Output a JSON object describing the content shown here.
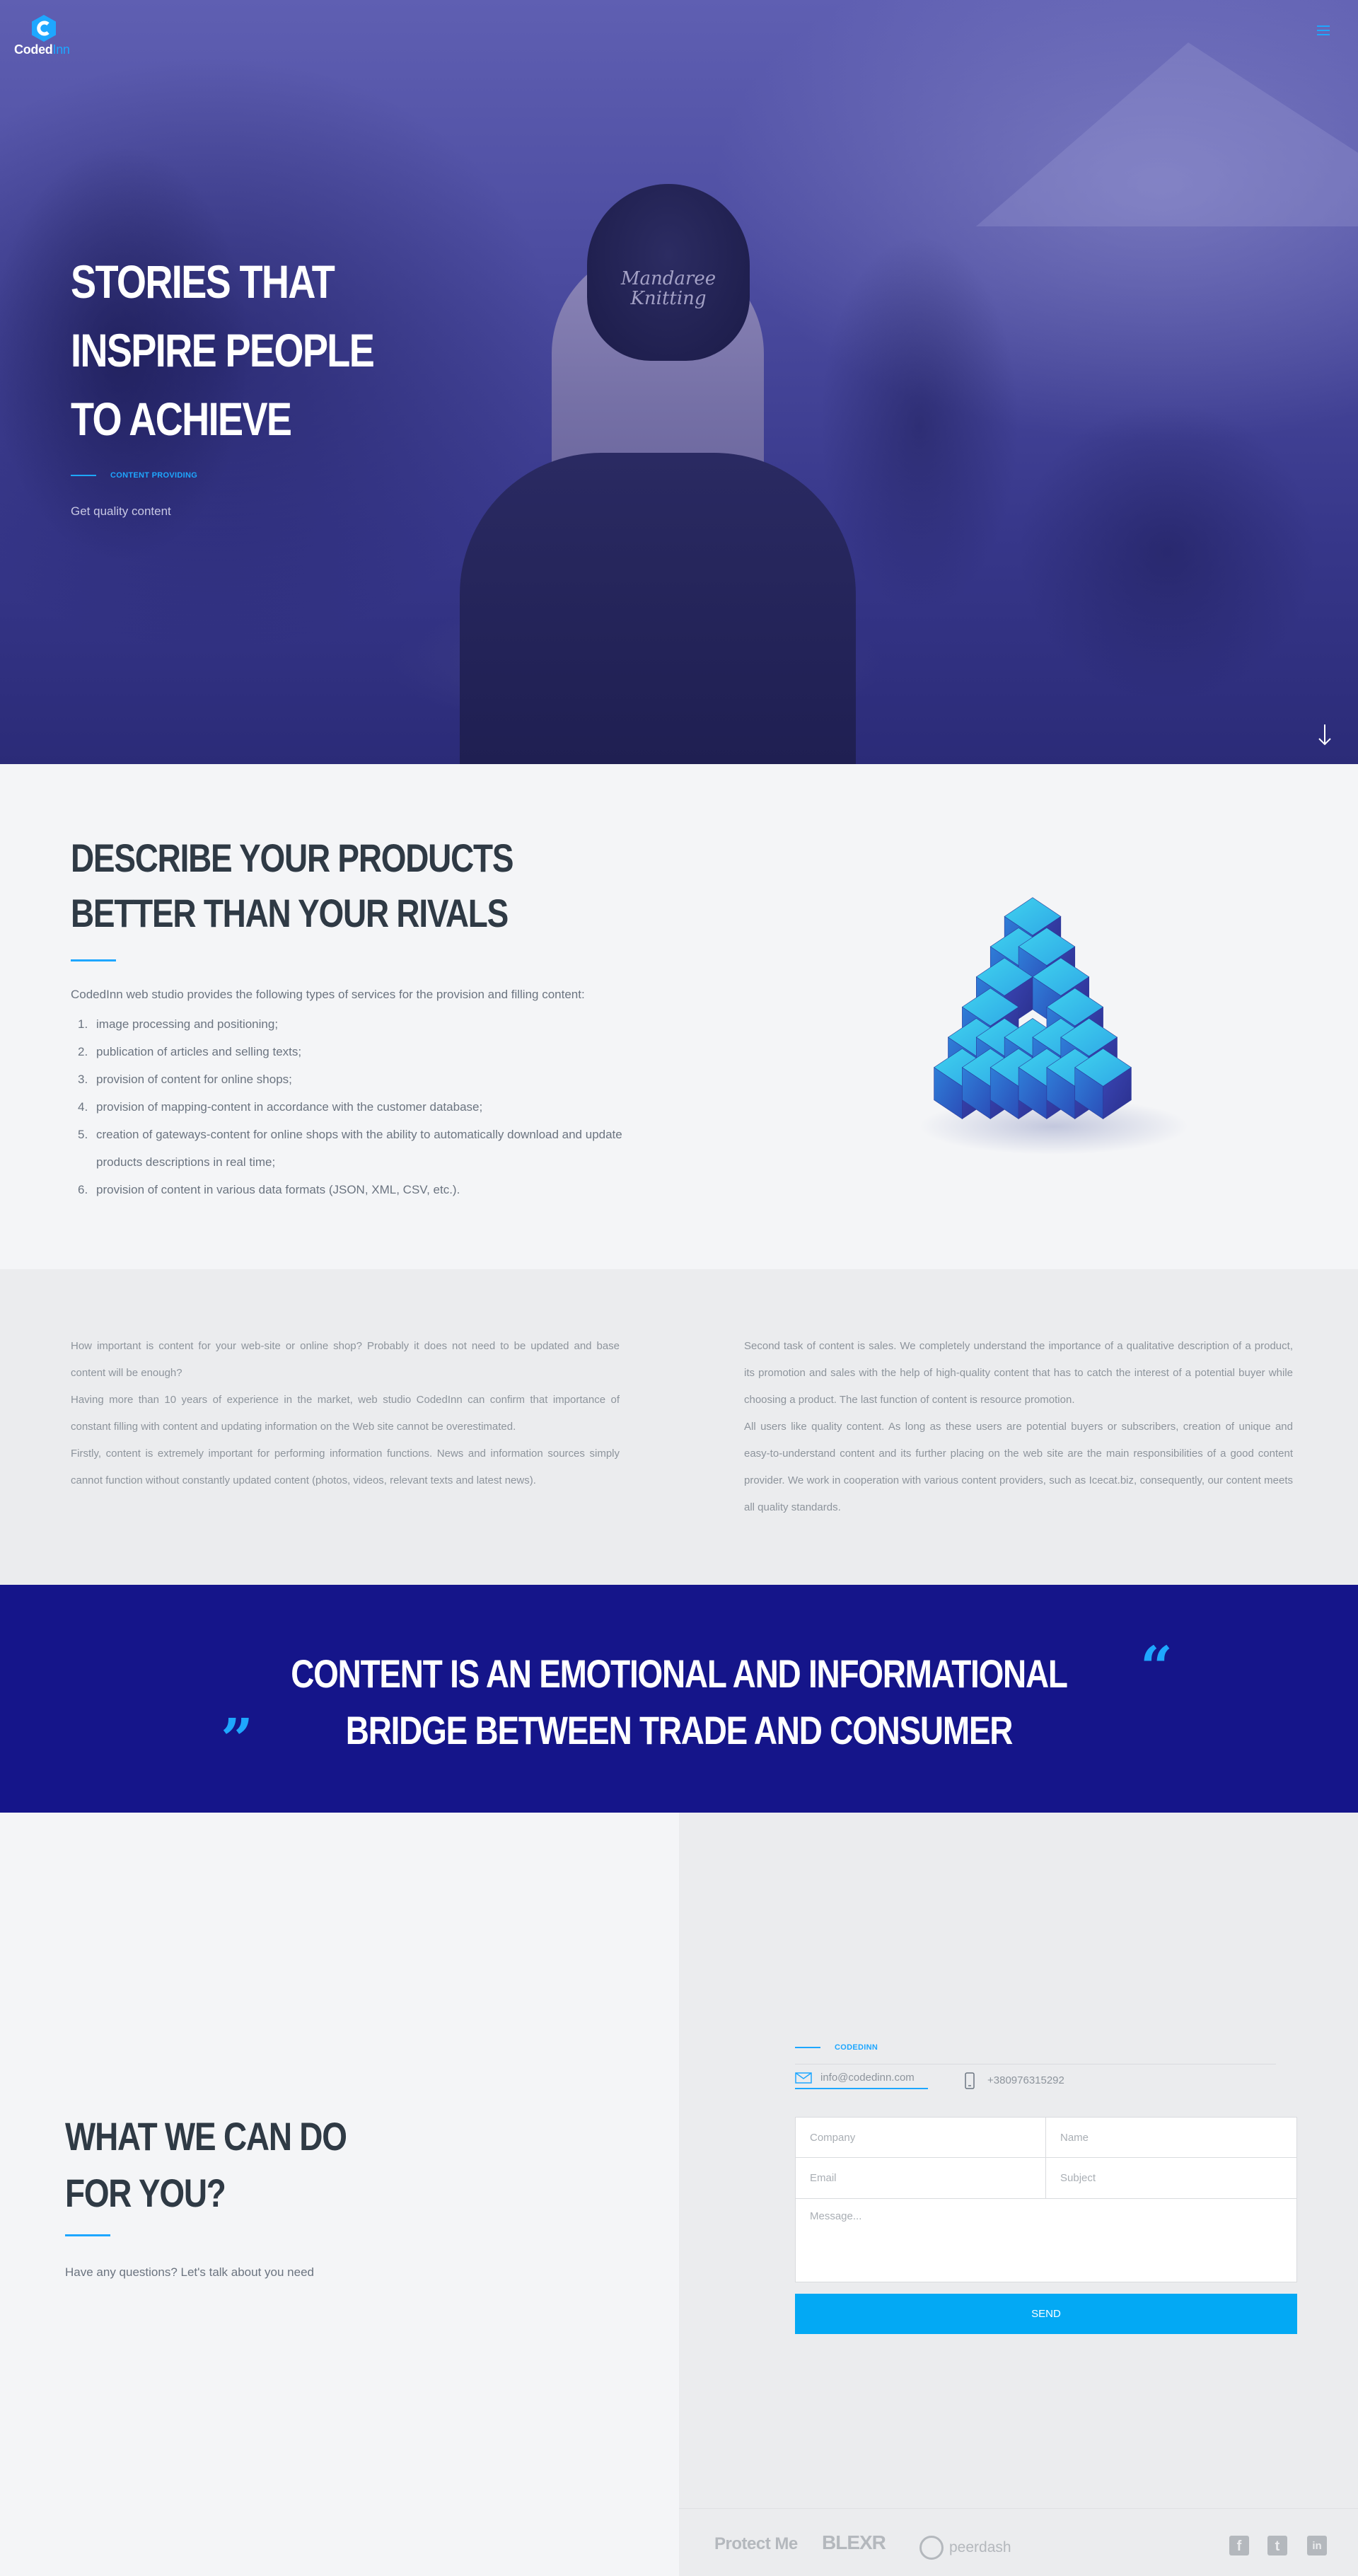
{
  "brand": {
    "logo_main": "Coded",
    "logo_accent": "Inn",
    "accent_color": "#1ea7ff"
  },
  "hero": {
    "title": "STORIES THAT INSPIRE PEOPLE TO ACHIEVE",
    "eyebrow": "CONTENT PROVIDING",
    "subtitle": "Get quality content",
    "cap_text": "Mandaree Knitting"
  },
  "products": {
    "title": "DESCRIBE YOUR PRODUCTS BETTER THAN YOUR RIVALS",
    "intro": "CodedInn web studio provides the following types of services for the provision and filling content:",
    "services": [
      {
        "num": "1.",
        "text": "image processing and positioning;"
      },
      {
        "num": "2.",
        "text": "publication of articles and selling texts;"
      },
      {
        "num": "3.",
        "text": "provision of content for online shops;"
      },
      {
        "num": "4.",
        "text": "provision of mapping-content in accordance with the customer database;"
      },
      {
        "num": "5.",
        "text": "creation of gateways-content for online shops with the ability to automatically download and update products descriptions in real time;"
      },
      {
        "num": "6.",
        "text": "provision of content in various data formats (JSON, XML, CSV, etc.)."
      }
    ]
  },
  "about": {
    "left": [
      "How important is content for your web-site or online shop? Probably it does not need to be updated and base content will be enough?",
      "Having more than 10 years of experience in the market, web studio CodedInn can confirm that importance of constant filling with content and updating information on the Web site cannot be overestimated.",
      "Firstly, content is extremely important for performing information functions. News and information sources simply cannot function without constantly updated content (photos, videos, relevant texts and latest news)."
    ],
    "right": [
      "Second task of content is sales. We completely understand the importance of a qualitative description of a product, its promotion and sales with the help of high-quality content that has to catch the interest of a potential buyer while choosing a product. The last function of content is resource promotion.",
      "All users like quality content. As long as these users are potential buyers or subscribers, creation of unique and easy-to-understand content and its further placing on the web site are the main responsibilities of a good content provider. We work in cooperation with various content providers, such as Icecat.biz, consequently, our content meets all quality standards."
    ]
  },
  "quote": {
    "text": "CONTENT IS AN EMOTIONAL AND INFORMATIONAL BRIDGE BETWEEN TRADE AND CONSUMER",
    "open_mark": "“",
    "close_mark": "”"
  },
  "contact": {
    "title": "WHAT WE CAN DO FOR YOU?",
    "subtitle": "Have any questions? Let's talk about you need",
    "eyebrow": "CODEDINN",
    "email": "info@codedinn.com",
    "phone": "+380976315292",
    "form": {
      "company_placeholder": "Company",
      "name_placeholder": "Name",
      "email_placeholder": "Email",
      "subject_placeholder": "Subject",
      "message_placeholder": "Message...",
      "send_label": "SEND"
    }
  },
  "footer": {
    "partners": [
      "Protect Me",
      "BLEXR",
      "peerdash"
    ],
    "social": [
      {
        "icon": "facebook-icon",
        "glyph": "f"
      },
      {
        "icon": "twitter-icon",
        "glyph": "t"
      },
      {
        "icon": "linkedin-icon",
        "glyph": "in"
      }
    ]
  }
}
